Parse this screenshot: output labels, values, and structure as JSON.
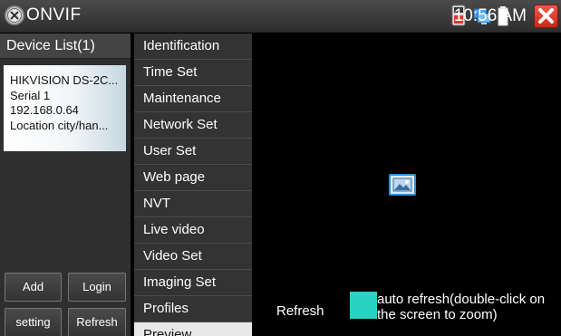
{
  "app": {
    "title": "ONVIF"
  },
  "status": {
    "time": "10:56 AM"
  },
  "colors": {
    "accent_checkbox": "#29d3c4",
    "close_button": "#d7392a",
    "image_icon_border": "#2e8fd8"
  },
  "device_list": {
    "header": "Device List(1)",
    "device": {
      "name": "HIKVISION DS-2C...",
      "serial": "Serial  1",
      "ip": "192.168.0.64",
      "location": "Location  city/han..."
    }
  },
  "buttons": {
    "add": "Add",
    "login": "Login",
    "setting": "setting",
    "refresh": "Refresh"
  },
  "menu": {
    "items": [
      "Identification",
      "Time Set",
      "Maintenance",
      "Network Set",
      "User Set",
      "Web page",
      "NVT",
      "Live video",
      "Video Set",
      "Imaging Set",
      "Profiles",
      "Preview"
    ],
    "active_index": 11
  },
  "preview": {
    "refresh_label": "Refresh",
    "auto_refresh_label": "auto refresh(double-click on the screen to zoom)"
  },
  "icons": [
    "onvif-app-icon",
    "tester-icon",
    "network-icon",
    "battery-icon",
    "close-icon",
    "image-icon"
  ]
}
